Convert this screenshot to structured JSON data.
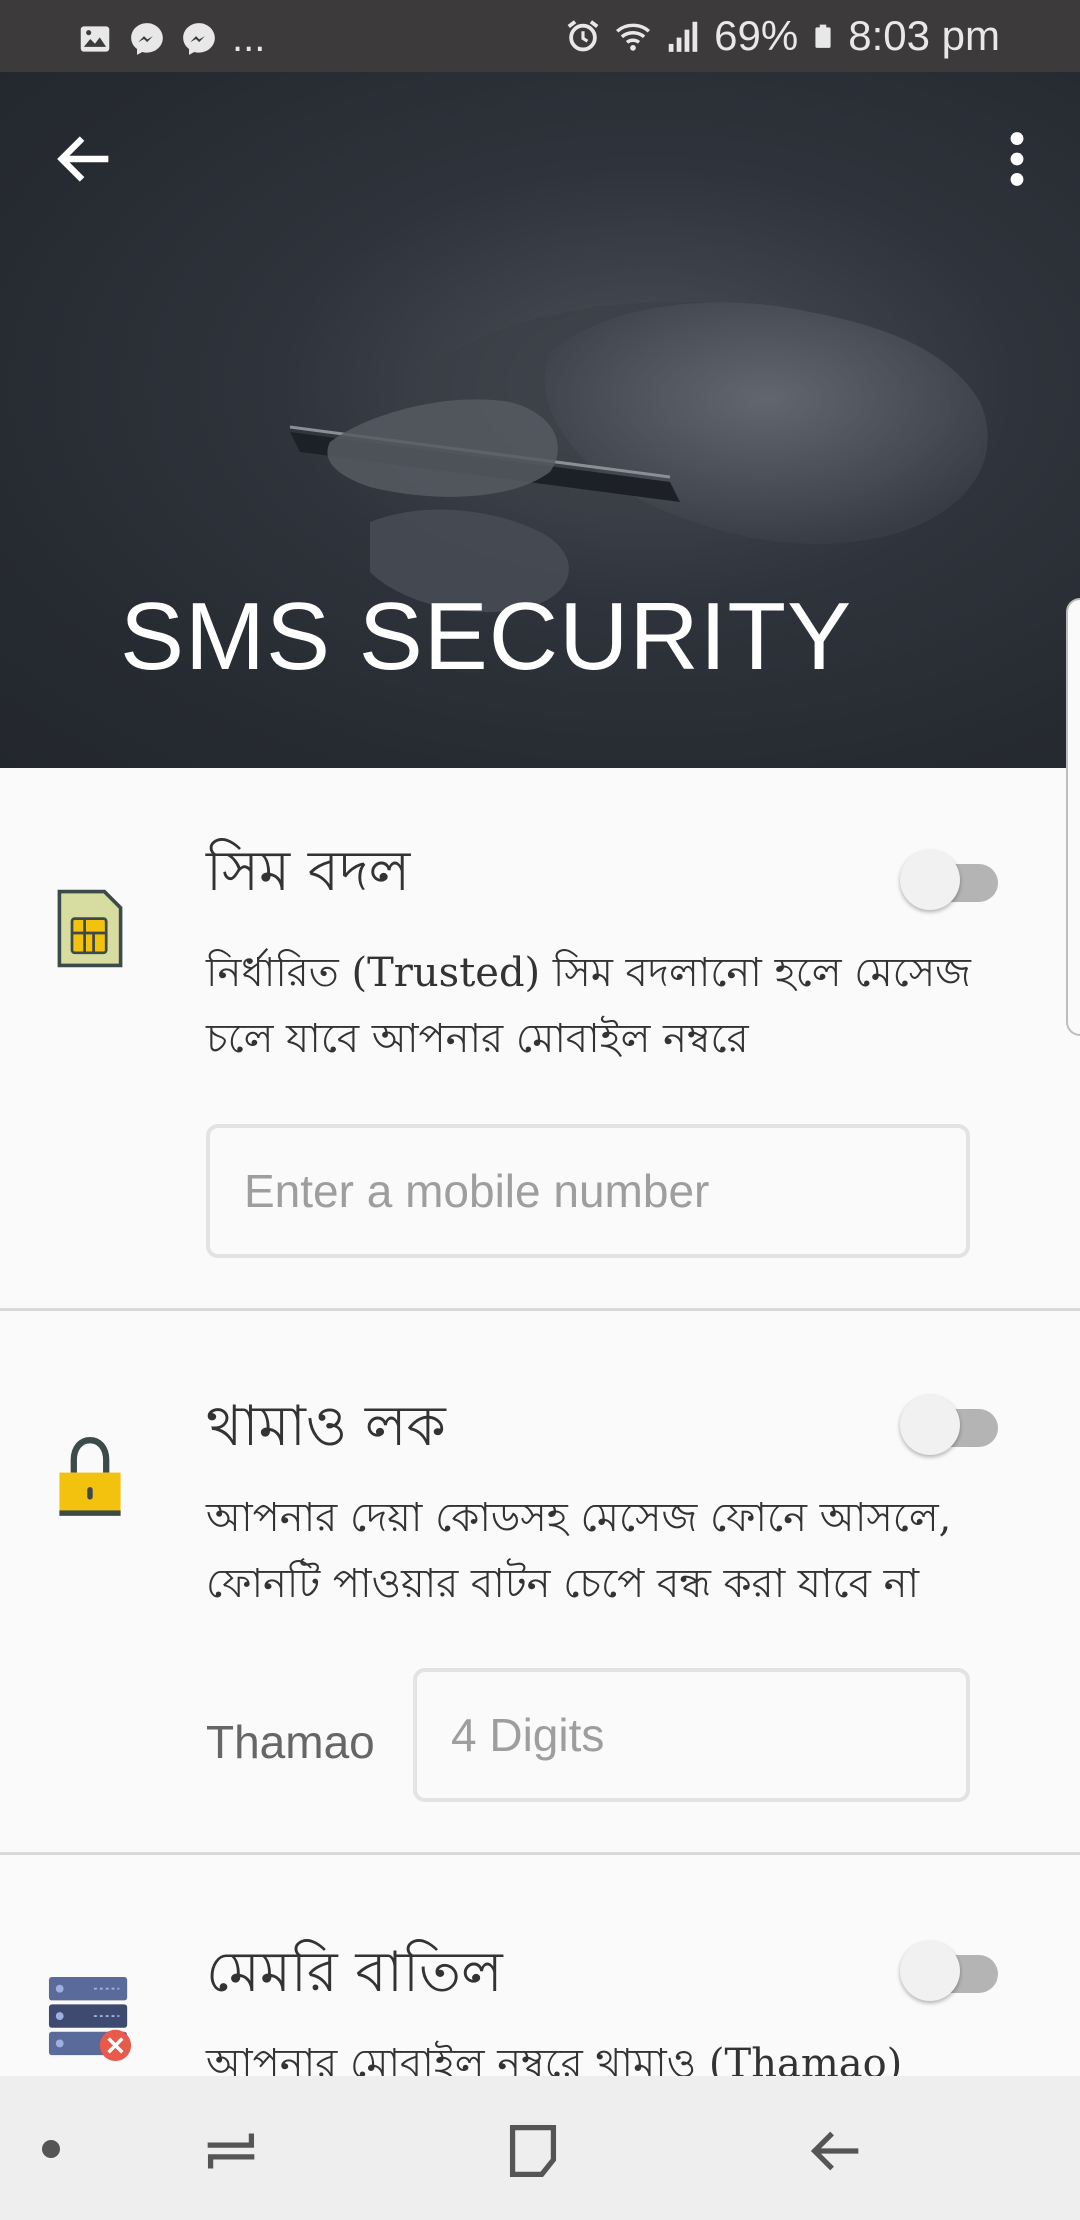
{
  "status_bar": {
    "notification_more": "...",
    "battery": "69%",
    "time": "8:03 pm",
    "icons": [
      "image-icon",
      "messenger-icon",
      "messenger-icon",
      "alarm-icon",
      "wifi-icon",
      "signal-icon",
      "battery-icon"
    ]
  },
  "header": {
    "title": "SMS SECURITY",
    "back_icon": "arrow-left-icon",
    "menu_icon": "more-vert-icon"
  },
  "sections": [
    {
      "icon": "sim-card-icon",
      "title": "সিম বদল",
      "description": "নির্ধারিত (Trusted) সিম বদলানো হলে মেসেজ চলে যাবে আপনার মোবাইল নম্বরে",
      "toggle_on": false,
      "input_placeholder": "Enter a mobile number"
    },
    {
      "icon": "lock-icon",
      "title": "থামাও লক",
      "description": "আপনার দেয়া কোডসহ মেসেজ ফোনে আসলে, ফোনটি পাওয়ার বাটন চেপে বন্ধ করা যাবে না",
      "toggle_on": false,
      "field_label": "Thamao",
      "input_placeholder": "4 Digits"
    },
    {
      "icon": "server-delete-icon",
      "title": "মেমরি বাতিল",
      "description": "আপনার মোবাইল নম্বরে থামাও (Thamao)",
      "toggle_on": false
    }
  ],
  "nav_bar": {
    "icons": [
      "dot-icon",
      "recents-icon",
      "home-icon",
      "back-icon"
    ]
  },
  "colors": {
    "status_bar": "#3c3a3b",
    "header_bg": "#262a31",
    "page_bg": "#fafafa",
    "toggle_off_track": "#b4b4b4",
    "sim_icon": "#d7dca0",
    "lock_icon": "#f2c20f"
  }
}
